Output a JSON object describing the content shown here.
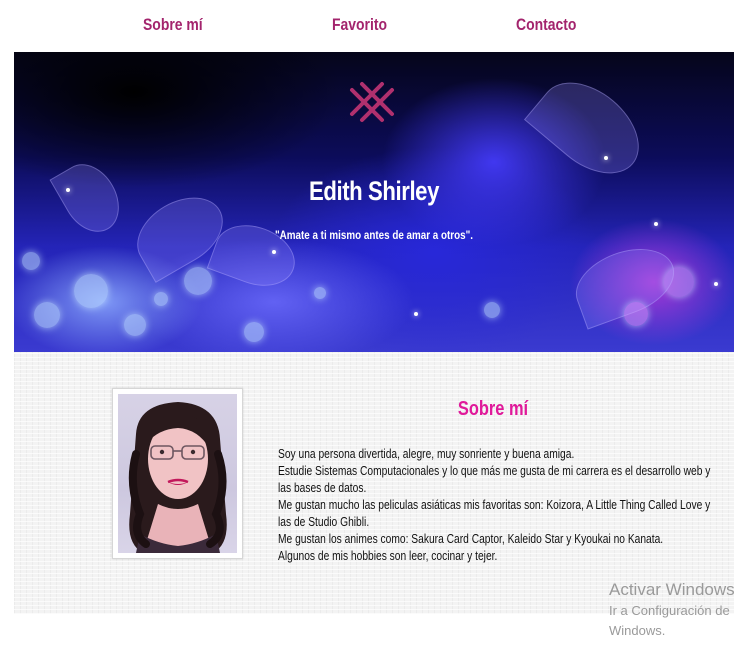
{
  "nav": {
    "items": [
      {
        "label": "Sobre mí"
      },
      {
        "label": "Favorito"
      },
      {
        "label": "Contacto"
      }
    ],
    "color": "#a3246d"
  },
  "hero": {
    "logo_icon": "crosshatch-icon",
    "name": "Edith Shirley",
    "quote": "\"Amate a ti mismo antes de amar a otros\"."
  },
  "about": {
    "title": "Sobre mí",
    "title_color": "#e0199a",
    "photo_icon": "profile-photo",
    "paragraphs": [
      "Soy una persona divertida, alegre, muy sonriente y buena amiga.",
      "Estudie Sistemas Computacionales y lo que más me gusta de mi carrera es el desarrollo web y las bases de datos.",
      "Me gustan mucho las peliculas asiáticas mis favoritas son: Koizora, A Little Thing Called Love y las de Studio Ghibli.",
      "Me gustan los animes como: Sakura Card Captor, Kaleido Star y Kyoukai no Kanata.",
      "Algunos de mis hobbies son leer, cocinar y tejer."
    ]
  },
  "watermark": {
    "title": "Activar Windows",
    "subtitle_line1": "Ir a Configuración de",
    "subtitle_line2": "Windows."
  }
}
